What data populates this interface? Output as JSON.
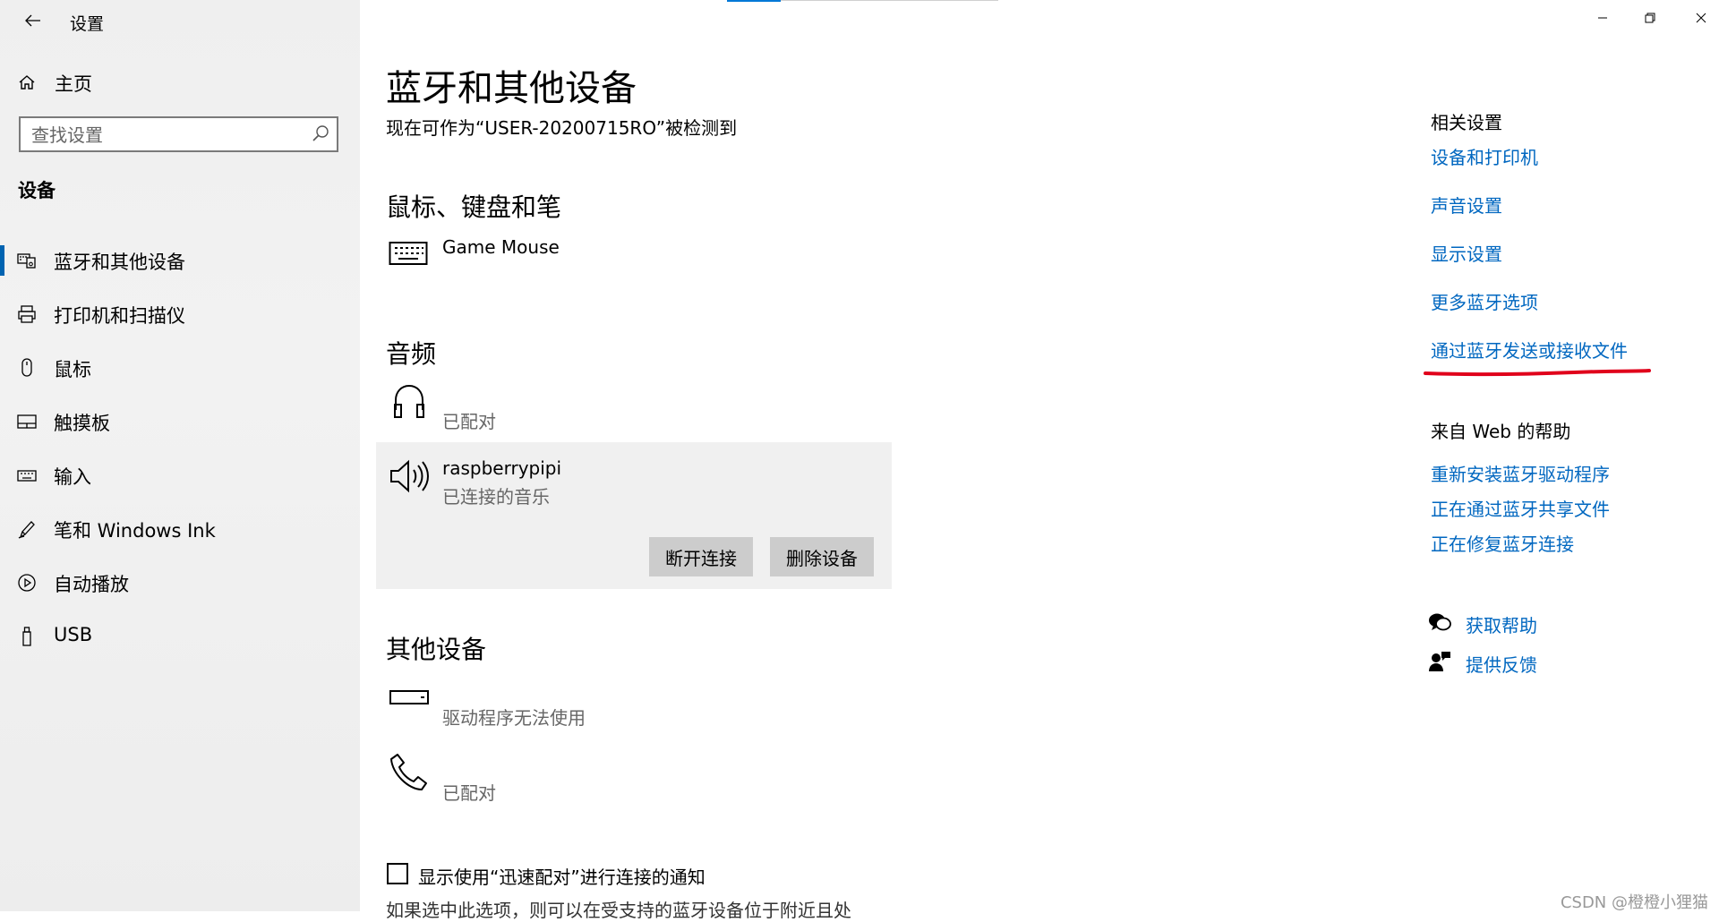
{
  "window": {
    "title": "设置",
    "controls": [
      "minimize",
      "restore",
      "close"
    ]
  },
  "sidebar": {
    "home_label": "主页",
    "search_placeholder": "查找设置",
    "section_header": "设备",
    "items": [
      {
        "label": "蓝牙和其他设备",
        "icon": "bluetooth-devices-icon",
        "active": true
      },
      {
        "label": "打印机和扫描仪",
        "icon": "printer-icon",
        "active": false
      },
      {
        "label": "鼠标",
        "icon": "mouse-icon",
        "active": false
      },
      {
        "label": "触摸板",
        "icon": "touchpad-icon",
        "active": false
      },
      {
        "label": "输入",
        "icon": "keyboard-icon",
        "active": false
      },
      {
        "label": "笔和 Windows Ink",
        "icon": "pen-icon",
        "active": false
      },
      {
        "label": "自动播放",
        "icon": "autoplay-icon",
        "active": false
      },
      {
        "label": "USB",
        "icon": "usb-icon",
        "active": false
      }
    ]
  },
  "main": {
    "title": "蓝牙和其他设备",
    "subtitle": "现在可作为“USER-20200715RO”被检测到",
    "mouse_section": {
      "heading": "鼠标、键盘和笔",
      "devices": [
        {
          "name": "Game Mouse",
          "icon": "keyboard-icon"
        }
      ]
    },
    "audio_section": {
      "heading": "音频",
      "devices": [
        {
          "name": "",
          "status": "已配对",
          "icon": "headphones-icon"
        },
        {
          "name": "raspberrypipi",
          "status": "已连接的音乐",
          "icon": "speaker-icon",
          "selected": true
        }
      ],
      "disconnect_label": "断开连接",
      "remove_label": "删除设备"
    },
    "other_section": {
      "heading": "其他设备",
      "devices": [
        {
          "status": "驱动程序无法使用",
          "icon": "generic-device-icon"
        },
        {
          "status": "已配对",
          "icon": "phone-icon"
        }
      ]
    },
    "swift_pair_checkbox": {
      "label": "显示使用“迅速配对”进行连接的通知",
      "checked": false
    },
    "swift_pair_description": "如果选中此选项，则可以在受支持的蓝牙设备位于附近且处"
  },
  "related": {
    "heading": "相关设置",
    "links": [
      "设备和打印机",
      "声音设置",
      "显示设置",
      "更多蓝牙选项",
      "通过蓝牙发送或接收文件"
    ],
    "annotation_color": "#e0001b"
  },
  "web_help": {
    "heading": "来自 Web 的帮助",
    "links": [
      "重新安装蓝牙驱动程序",
      "正在通过蓝牙共享文件",
      "正在修复蓝牙连接"
    ]
  },
  "support": {
    "get_help": "获取帮助",
    "feedback": "提供反馈"
  },
  "watermark": "CSDN @橙橙小狸猫",
  "colors": {
    "accent": "#0078d7",
    "link": "#0067c0",
    "sidebar_bg": "#f0f0f0"
  }
}
